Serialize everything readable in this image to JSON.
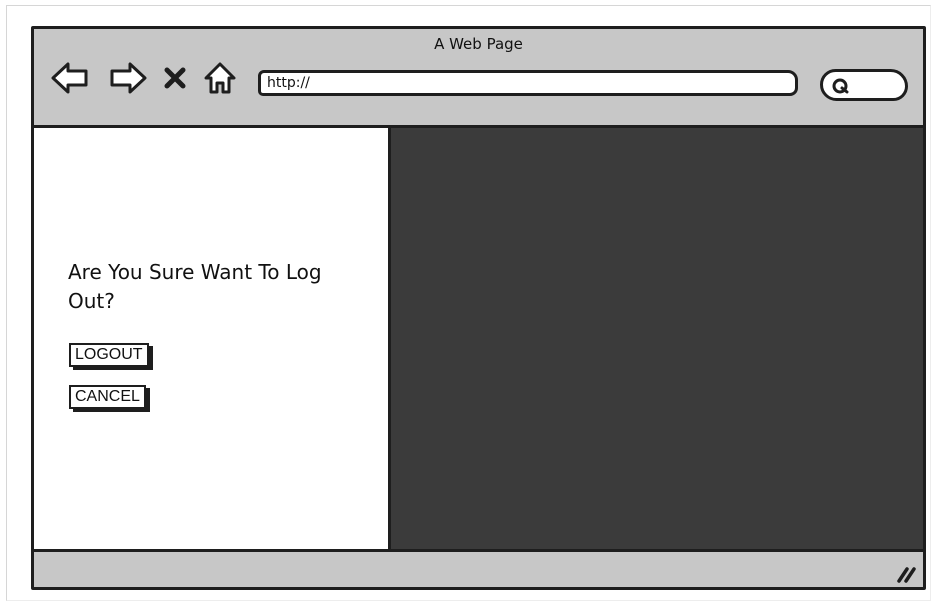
{
  "window": {
    "title": "A Web Page"
  },
  "toolbar": {
    "back_icon": "left-arrow-icon",
    "forward_icon": "right-arrow-icon",
    "stop_icon": "close-x-icon",
    "home_icon": "home-icon",
    "search_icon": "search-icon"
  },
  "address_bar": {
    "value": "http://"
  },
  "dialog": {
    "question": "Are You Sure Want To Log Out?",
    "logout_label": "LOGOUT",
    "cancel_label": "CANCEL"
  },
  "colors": {
    "chrome": "#c7c7c7",
    "outline": "#1e1e1e",
    "content_left": "#ffffff",
    "content_right": "#3b3b3b"
  }
}
